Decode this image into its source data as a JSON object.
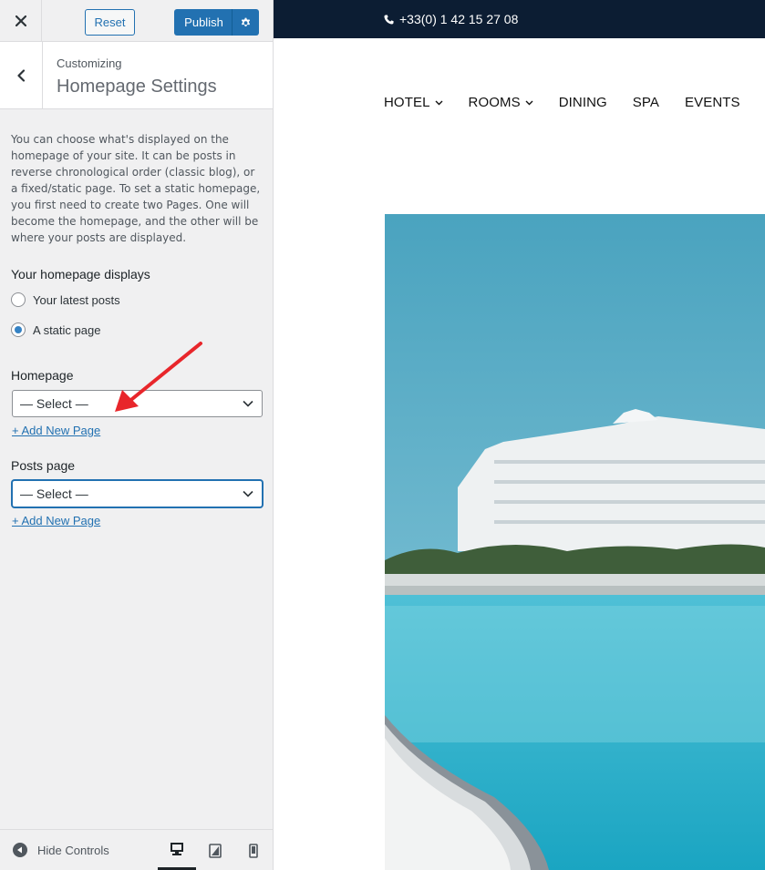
{
  "sidebar": {
    "topbar": {
      "close_icon": "close-icon",
      "reset_label": "Reset",
      "publish_label": "Publish",
      "settings_icon": "gear-icon"
    },
    "header": {
      "back_icon": "chevron-left-icon",
      "customizing_label": "Customizing",
      "section_title": "Homepage Settings"
    },
    "description": "You can choose what's displayed on the homepage of your site. It can be posts in reverse chronological order (classic blog), or a fixed/static page. To set a static homepage, you first need to create two Pages. One will become the homepage, and the other will be where your posts are displayed.",
    "homepage_displays": {
      "label": "Your homepage displays",
      "options": [
        {
          "label": "Your latest posts",
          "checked": false
        },
        {
          "label": "A static page",
          "checked": true
        }
      ]
    },
    "homepage_select": {
      "label": "Homepage",
      "value": "— Select —",
      "add_link": "+ Add New Page"
    },
    "posts_select": {
      "label": "Posts page",
      "value": "— Select —",
      "add_link": "+ Add New Page"
    },
    "footer": {
      "hide_controls_label": "Hide Controls",
      "devices": [
        "desktop-icon",
        "tablet-icon",
        "mobile-icon"
      ],
      "active_device": "desktop"
    }
  },
  "preview": {
    "phone": "+33(0) 1 42 15 27 08",
    "nav": [
      {
        "label": "HOTEL",
        "dropdown": true
      },
      {
        "label": "ROOMS",
        "dropdown": true
      },
      {
        "label": "DINING",
        "dropdown": false
      },
      {
        "label": "SPA",
        "dropdown": false
      },
      {
        "label": "EVENTS",
        "dropdown": false
      }
    ]
  },
  "colors": {
    "wp_blue": "#2271b1",
    "sidebar_bg": "#f0f0f1",
    "preview_topbar": "#0c1d33",
    "annotation_arrow": "#e8262b"
  }
}
